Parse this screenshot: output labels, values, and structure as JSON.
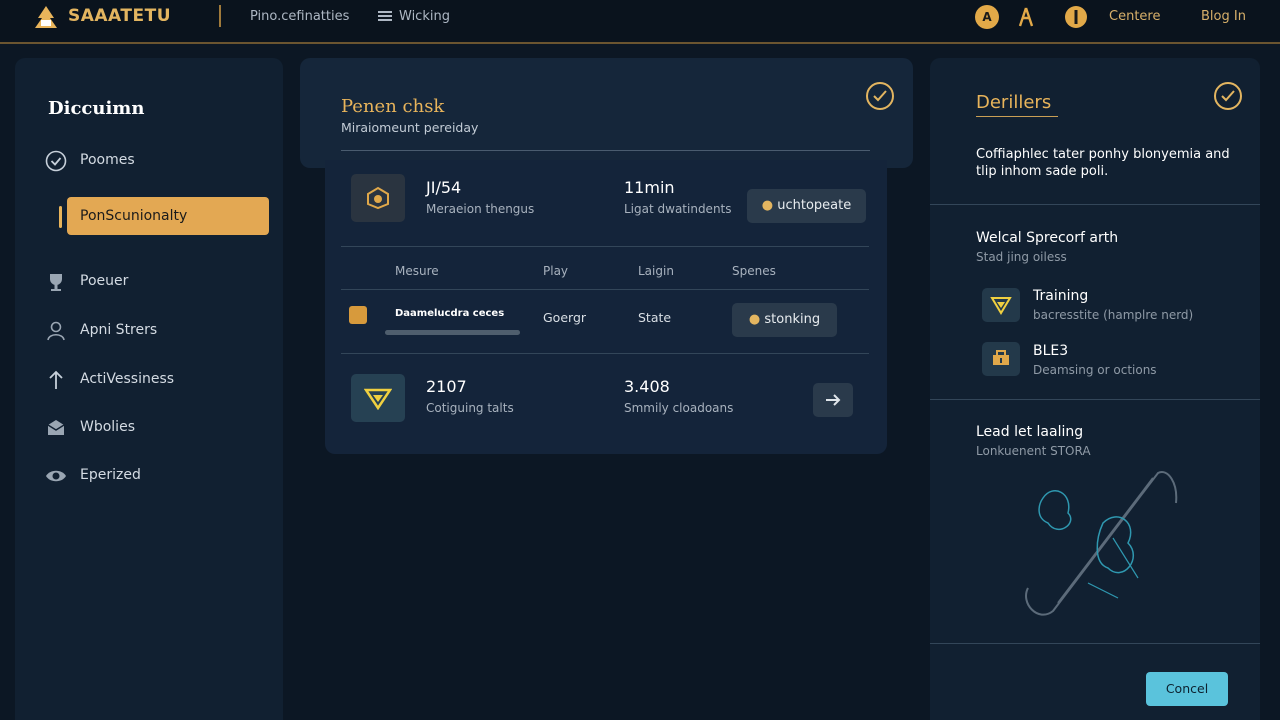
{
  "header": {
    "brand": "SAAATETU",
    "nav_links": [
      "Pino.cefinatties",
      "Wicking"
    ],
    "icon_letter": "A",
    "right_links": [
      "Centere",
      "Blog In"
    ]
  },
  "sidebar": {
    "title": "Diccuimn",
    "items": [
      {
        "label": "Poomes",
        "icon": "check-circle-icon"
      },
      {
        "label": "PonScunionalty",
        "icon": "active-marker",
        "active": true
      },
      {
        "label": "Poeuer",
        "icon": "trophy-icon"
      },
      {
        "label": "Apni Strers",
        "icon": "user-icon"
      },
      {
        "label": "ActiVessiness",
        "icon": "arrow-up-icon"
      },
      {
        "label": "Wbolies",
        "icon": "envelope-icon"
      },
      {
        "label": "Eperized",
        "icon": "eye-icon"
      }
    ]
  },
  "main": {
    "title": "Penen chsk",
    "subtitle": "Miraiomeunt pereiday",
    "stat1": {
      "value": "JI/54",
      "label": "Meraeion thengus"
    },
    "stat2": {
      "value": "11min",
      "label": "Ligat dwatindents"
    },
    "button1": "uchtopeate",
    "table": {
      "headers": [
        "Mesure",
        "Play",
        "Laigin",
        "Spenes"
      ],
      "row": {
        "name": "Daamelucdra ceces",
        "col2": "Goergr",
        "col3": "State",
        "action": "stonking",
        "progress": 1.0
      }
    },
    "stat3": {
      "value": "2107",
      "label": "Cotiguing talts"
    },
    "stat4": {
      "value": "3.408",
      "label": "Smmily cloadoans"
    }
  },
  "details": {
    "title": "Derillers",
    "description": "Coffiaphlec tater ponhy blonyemia and tlip inhom sade poli.",
    "section1": {
      "title": "Welcal Sprecorf arth",
      "sub": "Stad jing oiless"
    },
    "items": [
      {
        "title": "Training",
        "sub": "bacresstite (hamplre nerd)"
      },
      {
        "title": "BLE3",
        "sub": "Deamsing or octions"
      }
    ],
    "section2": {
      "title": "Lead let laaling",
      "sub": "Lonkuenent STORA"
    },
    "cancel": "Concel"
  },
  "colors": {
    "accent": "#e3a853",
    "cancel": "#5ac3dc",
    "background": "#0c1724"
  }
}
